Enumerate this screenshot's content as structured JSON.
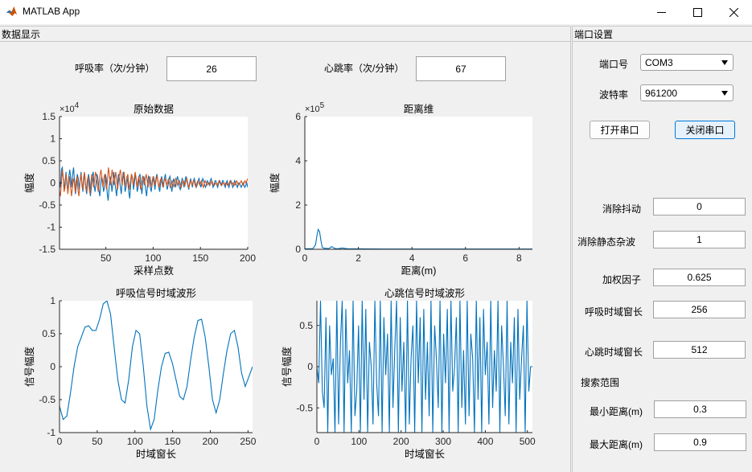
{
  "window": {
    "title": "MATLAB App"
  },
  "data_panel": {
    "title": "数据显示",
    "breath_label": "呼吸率（次/分钟）",
    "breath_value": "26",
    "heart_label": "心跳率（次/分钟）",
    "heart_value": "67"
  },
  "serial_panel": {
    "title": "端口设置",
    "port_label": "端口号",
    "port_value": "COM3",
    "baud_label": "波特率",
    "baud_value": "961200",
    "open_button": "打开串口",
    "close_button": "关闭串口",
    "params": [
      {
        "label": "消除抖动",
        "value": "0"
      },
      {
        "label": "消除静态杂波",
        "value": "1"
      },
      {
        "label": "加权因子",
        "value": "0.625"
      },
      {
        "label": "呼吸时域窗长",
        "value": "256"
      },
      {
        "label": "心跳时域窗长",
        "value": "512"
      }
    ],
    "search_label": "搜索范围",
    "min_label": "最小距离(m)",
    "min_value": "0.3",
    "max_label": "最大距离(m)",
    "max_value": "0.9"
  },
  "colors": {
    "series1": "#0072bd",
    "series2": "#d95319"
  },
  "chart_data": [
    {
      "id": "raw",
      "type": "line",
      "title": "原始数据",
      "xlabel": "采样点数",
      "ylabel": "幅度",
      "exponent": "×10",
      "exponent_power": "4",
      "xlim": [
        1,
        200
      ],
      "ylim": [
        -1.5,
        1.5
      ],
      "xticks": [
        50,
        100,
        150,
        200
      ],
      "yticks": [
        -1.5,
        -1,
        -0.5,
        0,
        0.5,
        1,
        1.5
      ],
      "yticklabels": [
        "-1.5",
        "-1",
        "-0.5",
        "0",
        "0.5",
        "1",
        "1.5"
      ],
      "series": [
        {
          "color": "#0072bd",
          "values": [
            0.05,
            -0.1,
            0.3,
            0.35,
            0.1,
            -0.15,
            0.05,
            0.25,
            -0.05,
            -0.2,
            0.15,
            0.3,
            0.1,
            -0.1,
            0.2,
            0.35,
            0.05,
            -0.25,
            -0.05,
            0.2,
            0.1,
            -0.15,
            0.05,
            0.25,
            -0.05,
            -0.2,
            0.1,
            0.2,
            -0.1,
            -0.25,
            0.0,
            0.2,
            0.05,
            -0.3,
            -0.1,
            0.15,
            0.25,
            -0.05,
            -0.2,
            0.0,
            0.2,
            0.1,
            -0.15,
            -0.3,
            -0.05,
            0.15,
            0.05,
            -0.2,
            -0.1,
            0.2,
            0.1,
            -0.25,
            -0.4,
            -0.1,
            0.15,
            0.05,
            -0.2,
            0.0,
            0.25,
            0.05,
            -0.15,
            -0.3,
            0.0,
            0.2,
            0.1,
            -0.1,
            -0.25,
            0.05,
            0.25,
            0.1,
            -0.2,
            -0.1,
            0.15,
            0.0,
            -0.2,
            -0.35,
            -0.05,
            0.2,
            0.1,
            -0.15,
            0.0,
            0.2,
            0.05,
            -0.2,
            -0.1,
            0.15,
            0.2,
            -0.05,
            -0.25,
            0.0,
            0.15,
            0.05,
            -0.15,
            -0.3,
            -0.05,
            0.15,
            0.1,
            -0.1,
            -0.2,
            0.05,
            0.15,
            0.0,
            -0.15,
            0.1,
            0.2,
            0.05,
            -0.1,
            -0.2,
            0.0,
            0.15,
            0.05,
            -0.1,
            0.1,
            0.2,
            0.0,
            -0.15,
            -0.05,
            0.1,
            0.15,
            -0.05,
            -0.2,
            0.0,
            0.1,
            0.0,
            -0.1,
            0.05,
            0.15,
            0.05,
            -0.1,
            -0.15,
            0.0,
            0.1,
            0.05,
            -0.1,
            0.05,
            0.15,
            0.05,
            -0.05,
            -0.15,
            0.0,
            0.1,
            0.0,
            -0.1,
            0.05,
            0.1,
            0.0,
            -0.1,
            -0.05,
            0.05,
            0.1,
            0.0,
            -0.1,
            0.0,
            0.1,
            0.05,
            -0.05,
            -0.1,
            0.0,
            0.05,
            0.0,
            -0.05,
            0.05,
            0.1,
            0.0,
            -0.1,
            -0.05,
            0.05,
            0.05,
            -0.05,
            -0.1,
            0.0,
            0.05,
            0.0,
            -0.05,
            0.05,
            0.05,
            -0.05,
            -0.1,
            0.0,
            0.05,
            -0.05,
            -0.1,
            0.0,
            0.05,
            0.0,
            -0.1,
            -0.05,
            0.05,
            0.0,
            -0.05,
            -0.1,
            0.0,
            0.0,
            -0.05,
            -0.1,
            -0.05,
            0.0,
            -0.05,
            -0.1,
            -0.05,
            0.0,
            -0.1
          ]
        },
        {
          "color": "#d95319",
          "values": [
            -0.2,
            -0.3,
            0.0,
            0.3,
            0.1,
            -0.2,
            -0.1,
            0.2,
            0.05,
            -0.25,
            -0.05,
            0.15,
            -0.1,
            -0.3,
            -0.1,
            0.1,
            0.0,
            -0.2,
            0.05,
            0.15,
            -0.15,
            -0.3,
            -0.05,
            0.2,
            0.05,
            -0.15,
            0.1,
            0.25,
            0.0,
            -0.2,
            0.05,
            0.15,
            -0.1,
            -0.25,
            0.0,
            0.2,
            0.1,
            -0.1,
            0.05,
            0.25,
            0.15,
            -0.05,
            -0.2,
            0.0,
            0.2,
            0.3,
            0.1,
            -0.1,
            0.1,
            0.2,
            0.05,
            -0.15,
            0.05,
            0.35,
            0.2,
            -0.05,
            0.1,
            0.3,
            0.15,
            -0.05,
            0.1,
            0.25,
            0.05,
            -0.15,
            0.05,
            0.2,
            0.3,
            0.1,
            -0.05,
            0.15,
            0.25,
            0.05,
            -0.1,
            0.1,
            0.2,
            0.0,
            -0.15,
            0.05,
            0.2,
            0.1,
            -0.05,
            0.1,
            0.25,
            0.1,
            -0.1,
            0.05,
            0.15,
            0.0,
            -0.15,
            0.0,
            0.15,
            0.1,
            -0.05,
            0.1,
            0.2,
            0.05,
            -0.1,
            0.05,
            0.15,
            0.0,
            -0.1,
            0.05,
            0.15,
            0.05,
            -0.05,
            0.1,
            0.15,
            0.0,
            -0.1,
            0.05,
            0.1,
            0.0,
            -0.1,
            0.0,
            0.1,
            0.05,
            -0.05,
            0.0,
            0.1,
            0.0,
            -0.1,
            -0.05,
            0.05,
            0.0,
            -0.1,
            0.0,
            0.1,
            0.05,
            -0.05,
            0.0,
            0.05,
            -0.05,
            -0.1,
            0.0,
            0.05,
            0.0,
            -0.05,
            0.05,
            0.1,
            0.0,
            -0.1,
            -0.05,
            0.05,
            0.0,
            -0.05,
            0.05,
            0.05,
            -0.05,
            -0.1,
            0.0,
            0.05,
            0.0,
            -0.05,
            0.0,
            0.05,
            -0.05,
            -0.1,
            0.0,
            0.05,
            0.0,
            -0.05,
            0.0,
            0.0,
            -0.05,
            0.0,
            0.05,
            0.0,
            -0.05,
            -0.05,
            0.0,
            0.0,
            -0.05,
            0.0,
            0.05,
            0.0,
            -0.05,
            -0.05,
            0.0,
            0.0,
            -0.05,
            0.0,
            0.0,
            -0.05,
            -0.05,
            0.0,
            0.05,
            0.0,
            -0.05,
            0.0,
            0.0,
            -0.05,
            0.0,
            0.05,
            0.0,
            -0.05,
            0.0,
            0.0,
            0.05,
            0.0,
            -0.05,
            0.0,
            0.05,
            0.0,
            0.05,
            0.1
          ]
        }
      ]
    },
    {
      "id": "range",
      "type": "line",
      "title": "距离维",
      "xlabel": "距离(m)",
      "ylabel": "幅度",
      "exponent": "×10",
      "exponent_power": "5",
      "xlim": [
        0,
        8.5
      ],
      "ylim": [
        0,
        6
      ],
      "xticks": [
        0,
        2,
        4,
        6,
        8
      ],
      "yticks": [
        0,
        2,
        4,
        6
      ],
      "yticklabels": [
        "0",
        "2",
        "4",
        "6"
      ],
      "series": [
        {
          "color": "#0072bd",
          "x": [
            0,
            0.3,
            0.4,
            0.45,
            0.5,
            0.55,
            0.6,
            0.65,
            0.7,
            0.8,
            0.9,
            1.0,
            1.1,
            1.2,
            1.4,
            1.6,
            2.0,
            3.0,
            4.0,
            5.0,
            6.0,
            7.0,
            8.0,
            8.5
          ],
          "values": [
            0.02,
            0.03,
            0.2,
            0.6,
            0.9,
            0.8,
            0.4,
            0.1,
            0.05,
            0.04,
            0.03,
            0.12,
            0.05,
            0.02,
            0.06,
            0.02,
            0.02,
            0.01,
            0.01,
            0.01,
            0.01,
            0.01,
            0.01,
            0.01
          ]
        }
      ]
    },
    {
      "id": "breath",
      "type": "line",
      "title": "呼吸信号时域波形",
      "xlabel": "时域窗长",
      "ylabel": "信号幅度",
      "xlim": [
        0,
        256
      ],
      "ylim": [
        -1,
        1
      ],
      "xticks": [
        0,
        50,
        100,
        150,
        200,
        250
      ],
      "yticks": [
        -1,
        -0.5,
        0,
        0.5,
        1
      ],
      "yticklabels": [
        "-1",
        "-0.5",
        "0",
        "0.5",
        "1"
      ],
      "series": [
        {
          "color": "#0072bd",
          "values": [
            -0.6,
            -0.8,
            -0.75,
            -0.4,
            0.0,
            0.3,
            0.45,
            0.6,
            0.62,
            0.55,
            0.55,
            0.72,
            0.95,
            1.0,
            0.8,
            0.3,
            -0.2,
            -0.5,
            -0.55,
            -0.2,
            0.3,
            0.55,
            0.5,
            0.0,
            -0.6,
            -0.95,
            -0.8,
            -0.35,
            0.0,
            0.2,
            0.22,
            0.05,
            -0.2,
            -0.45,
            -0.5,
            -0.3,
            0.1,
            0.45,
            0.7,
            0.72,
            0.45,
            0.0,
            -0.5,
            -0.7,
            -0.5,
            -0.1,
            0.25,
            0.5,
            0.55,
            0.3,
            -0.1,
            -0.3,
            -0.15,
            0.0
          ]
        }
      ]
    },
    {
      "id": "heart",
      "type": "line",
      "title": "心跳信号时域波形",
      "xlabel": "时域窗长",
      "ylabel": "信号幅度",
      "xlim": [
        0,
        512
      ],
      "ylim": [
        -0.8,
        0.8
      ],
      "xticks": [
        0,
        100,
        200,
        300,
        400,
        500
      ],
      "yticks": [
        -0.5,
        0,
        0.5
      ],
      "yticklabels": [
        "-0.5",
        "0",
        "0.5"
      ],
      "series": [
        {
          "color": "#0072bd",
          "values": [
            0.0,
            -0.2,
            0.8,
            -0.3,
            -0.5,
            0.6,
            -0.8,
            0.5,
            -0.1,
            0.1,
            -0.8,
            0.8,
            -0.7,
            0.3,
            0.8,
            -0.8,
            0.7,
            -0.2,
            0.2,
            -0.8,
            0.8,
            -0.6,
            -0.3,
            0.5,
            -0.8,
            0.8,
            -0.4,
            0.7,
            -0.8,
            0.3,
            0.0,
            -0.7,
            0.8,
            -0.2,
            -0.6,
            0.8,
            -0.8,
            0.6,
            -0.1,
            0.4,
            -0.8,
            0.8,
            -0.5,
            0.2,
            0.8,
            -0.8,
            0.6,
            -0.3,
            0.3,
            -0.8,
            0.8,
            -0.7,
            0.1,
            0.5,
            -0.8,
            0.8,
            -0.2,
            0.6,
            -0.8,
            0.7,
            -0.4,
            0.3,
            -0.6,
            0.8,
            -0.8,
            0.5,
            0.1,
            -0.5,
            0.8,
            -0.8,
            0.4,
            -0.2,
            0.7,
            -0.8,
            0.8,
            -0.3,
            0.0,
            0.6,
            -0.8,
            0.8,
            -0.5,
            0.2,
            -0.7,
            0.8,
            -0.6,
            0.4,
            0.1,
            -0.8,
            0.8,
            -0.4,
            0.6,
            -0.8,
            0.7,
            -0.1,
            0.3,
            -0.7,
            0.8,
            -0.5,
            0.2,
            -0.3,
            0.8,
            -0.8,
            0.5,
            0.0,
            -0.6,
            0.8,
            -0.7,
            0.3,
            -0.2,
            0.6,
            -0.8,
            0.7,
            -0.4,
            0.1,
            0.5,
            -0.8,
            0.8,
            -0.3,
            0.0,
            0.0
          ]
        }
      ]
    }
  ]
}
